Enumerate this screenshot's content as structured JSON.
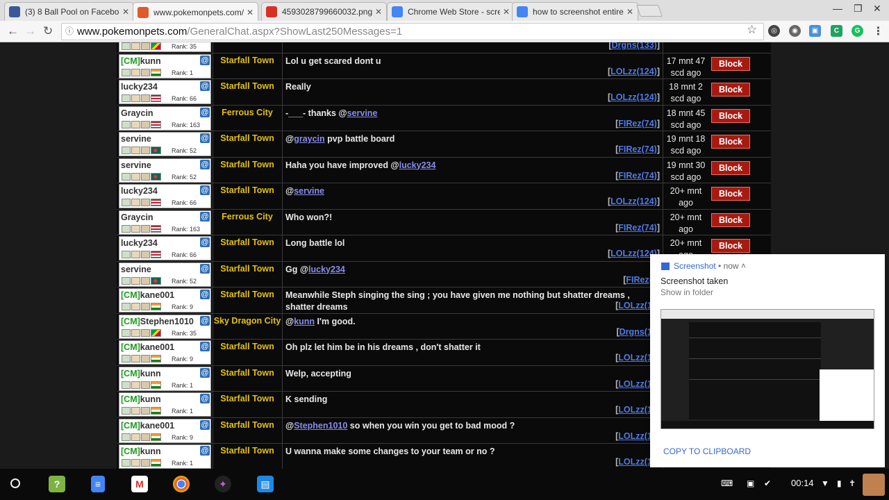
{
  "tabs": [
    {
      "title": "(3) 8 Ball Pool on Facebo",
      "favicon": "facebook-icon",
      "color": "#3b5998",
      "active": false
    },
    {
      "title": "www.pokemonpets.com/",
      "favicon": "pokeball-icon",
      "color": "#e05a2a",
      "active": true
    },
    {
      "title": "4593028799660032.png",
      "favicon": "image-file-icon",
      "color": "#d93025",
      "active": false
    },
    {
      "title": "Chrome Web Store - scre",
      "favicon": "web-store-icon",
      "color": "#4285f4",
      "active": false
    },
    {
      "title": "how to screenshot entire",
      "favicon": "google-icon",
      "color": "#4285f4",
      "active": false
    }
  ],
  "address": {
    "host": "www.pokemonpets.com",
    "path": "/GeneralChat.aspx?ShowLast250Messages=1"
  },
  "chat": {
    "block_label": "Block",
    "rows": [
      {
        "user": "",
        "cm": false,
        "rank": "Rank: 35",
        "location": "",
        "message": "",
        "mod": "Drgns(133)",
        "time": "scd ago",
        "block": false,
        "flag": "flag-guyana"
      },
      {
        "user": "kunn",
        "cm": true,
        "rank": "Rank: 1",
        "location": "Starfall Town",
        "message": "Lol u get scared dont u",
        "mod": "LOLzz(124)",
        "time": "17 mnt 47 scd ago",
        "block": true,
        "flag": "flag-india"
      },
      {
        "user": "lucky234",
        "cm": false,
        "rank": "Rank: 66",
        "location": "Starfall Town",
        "message": "Really",
        "mod": "LOLzz(124)",
        "time": "18 mnt 2 scd ago",
        "block": true,
        "flag": "flag-usa"
      },
      {
        "user": "Graycin",
        "cm": false,
        "rank": "Rank: 163",
        "location": "Ferrous City",
        "message": "-___- thanks @",
        "mention": "servine",
        "message_after": "",
        "mod": "FIRez(74)",
        "time": "18 mnt 45 scd ago",
        "block": true,
        "flag": "flag-usa"
      },
      {
        "user": "servine",
        "cm": false,
        "rank": "Rank: 52",
        "location": "Starfall Town",
        "message": "@",
        "mention": "graycin",
        "message_after": " pvp battle board",
        "mod": "FIRez(74)",
        "time": "19 mnt 18 scd ago",
        "block": true,
        "flag": "flag-bangladesh"
      },
      {
        "user": "servine",
        "cm": false,
        "rank": "Rank: 52",
        "location": "Starfall Town",
        "message": "Haha you have improved @",
        "mention": "lucky234",
        "message_after": "",
        "mod": "FIRez(74)",
        "time": "19 mnt 30 scd ago",
        "block": true,
        "flag": "flag-bangladesh"
      },
      {
        "user": "lucky234",
        "cm": false,
        "rank": "Rank: 66",
        "location": "Starfall Town",
        "message": "@",
        "mention": "servine",
        "message_after": "",
        "mod": "LOLzz(124)",
        "time": "20+ mnt ago",
        "block": true,
        "flag": "flag-usa"
      },
      {
        "user": "Graycin",
        "cm": false,
        "rank": "Rank: 163",
        "location": "Ferrous City",
        "message": "Who won?!",
        "mod": "FIRez(74)",
        "time": "20+ mnt ago",
        "block": true,
        "flag": "flag-usa"
      },
      {
        "user": "lucky234",
        "cm": false,
        "rank": "Rank: 66",
        "location": "Starfall Town",
        "message": "Long battle lol",
        "mod": "LOLzz(124)",
        "time": "20+ mnt ago",
        "block": true,
        "flag": "flag-usa"
      },
      {
        "user": "servine",
        "cm": false,
        "rank": "Rank: 52",
        "location": "Starfall Town",
        "message": "Gg @",
        "mention": "lucky234",
        "message_after": "",
        "mod": "FIRez(7",
        "time": "",
        "block": false,
        "flag": "flag-bangladesh"
      },
      {
        "user": "kane001",
        "cm": true,
        "rank": "Rank: 9",
        "location": "Starfall Town",
        "message": "Meanwhile Steph singing the sing ; you have given me nothing but shatter dreams , shatter dreams",
        "mod": "LOLzz(12",
        "time": "",
        "block": false,
        "flag": "flag-india"
      },
      {
        "user": "Stephen1010",
        "cm": true,
        "rank": "Rank: 35",
        "location": "Sky Dragon City",
        "message": "@",
        "mention": "kunn",
        "message_after": " I'm good.",
        "mod": "Drgns(13",
        "time": "",
        "block": false,
        "flag": "flag-guyana"
      },
      {
        "user": "kane001",
        "cm": true,
        "rank": "Rank: 9",
        "location": "Starfall Town",
        "message": "Oh plz let him be in his dreams , don't shatter it",
        "mod": "LOLzz(12",
        "time": "",
        "block": false,
        "flag": "flag-india"
      },
      {
        "user": "kunn",
        "cm": true,
        "rank": "Rank: 1",
        "location": "Starfall Town",
        "message": "Welp, accepting",
        "mod": "LOLzz(12",
        "time": "",
        "block": false,
        "flag": "flag-india"
      },
      {
        "user": "kunn",
        "cm": true,
        "rank": "Rank: 1",
        "location": "Starfall Town",
        "message": "K sending",
        "mod": "LOLzz(12",
        "time": "",
        "block": false,
        "flag": "flag-india"
      },
      {
        "user": "kane001",
        "cm": true,
        "rank": "Rank: 9",
        "location": "Starfall Town",
        "message": "@",
        "mention": "Stephen1010",
        "message_after": " so when you win you get to bad mood ?",
        "mod": "LOLzz(12",
        "time": "",
        "block": false,
        "flag": "flag-india"
      },
      {
        "user": "kunn",
        "cm": true,
        "rank": "Rank: 1",
        "location": "Starfall Town",
        "message": "U wanna make some changes to your team or no ?",
        "mod": "LOLzz(12",
        "time": "",
        "block": false,
        "flag": "flag-india"
      }
    ]
  },
  "notification": {
    "app": "Screenshot",
    "when": "now",
    "title": "Screenshot taken",
    "subtitle": "Show in folder",
    "action": "COPY TO CLIPBOARD"
  },
  "shelf": {
    "apps": [
      "help-icon",
      "docs-icon",
      "gmail-icon",
      "chrome-icon",
      "game-icon",
      "files-icon"
    ],
    "clock": "00:14"
  }
}
